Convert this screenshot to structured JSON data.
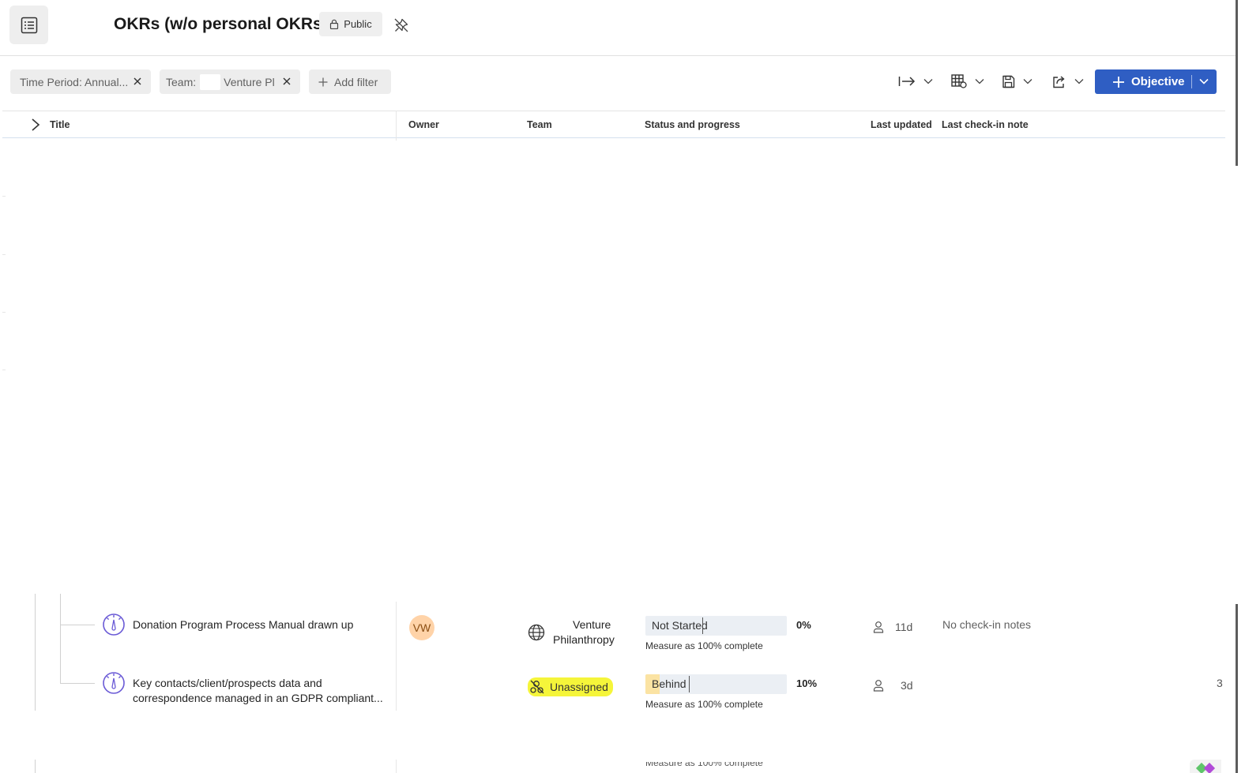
{
  "header": {
    "title": "OKRs (w/o personal OKRs)",
    "visibility_label": "Public"
  },
  "filters": {
    "time_period": "Time Period: Annual...",
    "team_prefix": "Team:",
    "team_value": "Venture Pl",
    "add_filter_label": "Add filter"
  },
  "toolbar": {
    "primary_button_label": "Objective",
    "accent_color": "#2f5ec3"
  },
  "table": {
    "columns": {
      "title": "Title",
      "owner": "Owner",
      "team": "Team",
      "status": "Status and progress",
      "last_updated": "Last updated",
      "last_note": "Last check-in note"
    },
    "rows": [
      {
        "title": "Donation Program Process Manual drawn up",
        "owner_initials": "VW",
        "team_line1": "Venture",
        "team_line2": "Philanthropy",
        "status": "Not Started",
        "progress_fraction": 0.0,
        "progress_pct": "0%",
        "measure": "Measure as 100% complete",
        "last_updated": "11d",
        "note": "No check-in notes"
      },
      {
        "title": "Key contacts/client/prospects data and correspondence managed in an GDPR compliant...",
        "team": "Unassigned",
        "status": "Behind",
        "progress_fraction": 0.1,
        "progress_pct": "10%",
        "measure": "Measure as 100% complete",
        "last_updated": "3d",
        "note_truncated": "3"
      }
    ],
    "partial_measure": "Measure as 100% complete"
  },
  "colors": {
    "status_behind": "#fbe3a3",
    "highlight": "#f5f53a",
    "okr_icon": "#6b5bd6"
  }
}
